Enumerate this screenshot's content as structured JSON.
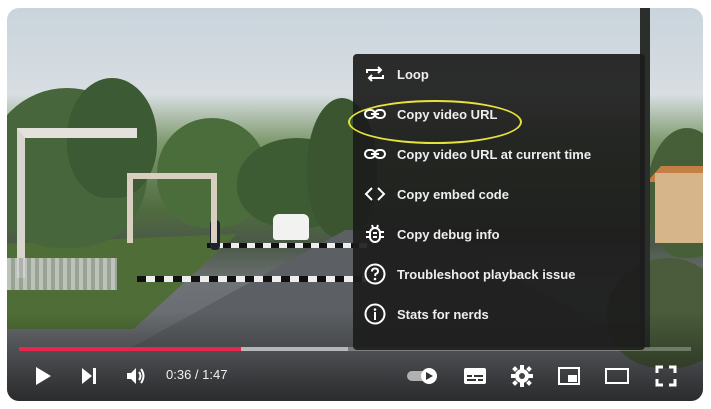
{
  "player": {
    "current_time": "0:36",
    "duration": "1:47",
    "time_display": "0:36 / 1:47",
    "progress_played": 0.33,
    "progress_loaded": 0.49,
    "accent_color": "#e8254f"
  },
  "context_menu": {
    "items": [
      {
        "label": "Loop",
        "icon": "loop-icon"
      },
      {
        "label": "Copy video URL",
        "icon": "link-icon"
      },
      {
        "label": "Copy video URL at current time",
        "icon": "link-icon"
      },
      {
        "label": "Copy embed code",
        "icon": "code-icon"
      },
      {
        "label": "Copy debug info",
        "icon": "bug-icon"
      },
      {
        "label": "Troubleshoot playback issue",
        "icon": "help-circle-icon"
      },
      {
        "label": "Stats for nerds",
        "icon": "info-circle-icon"
      }
    ],
    "highlight_color": "#e8e33a"
  },
  "controls": {
    "left": [
      "play-icon",
      "next-icon",
      "volume-icon"
    ],
    "right": [
      "autoplay-toggle-icon",
      "subtitles-icon",
      "settings-gear-icon",
      "miniplayer-icon",
      "theater-mode-icon",
      "fullscreen-icon"
    ]
  }
}
